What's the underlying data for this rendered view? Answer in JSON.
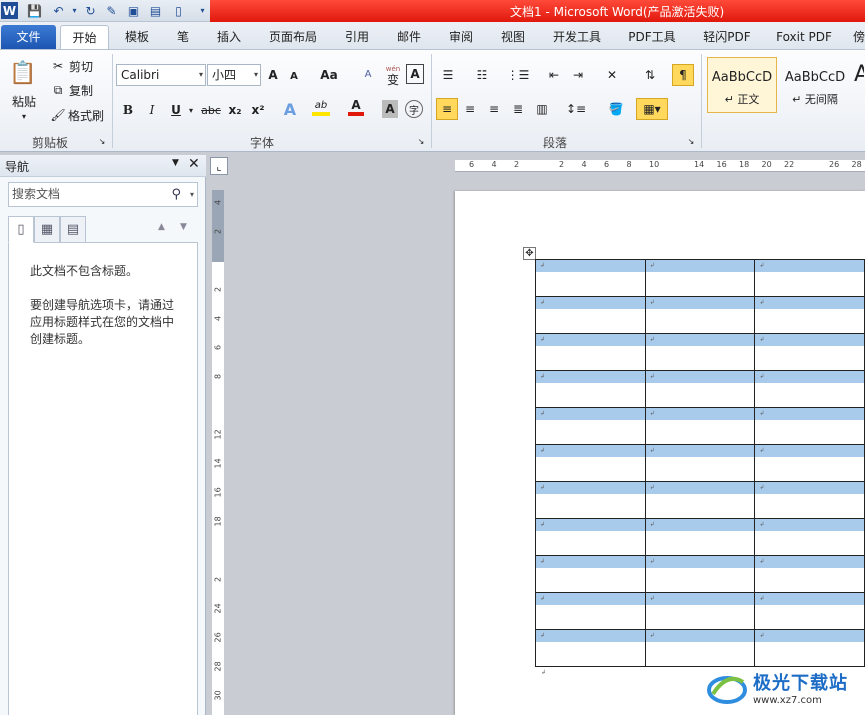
{
  "window": {
    "title": "文档1 - Microsoft Word(产品激活失败)"
  },
  "tabs": [
    {
      "label": "文件"
    },
    {
      "label": "开始"
    },
    {
      "label": "模板"
    },
    {
      "label": "笔"
    },
    {
      "label": "插入"
    },
    {
      "label": "页面布局"
    },
    {
      "label": "引用"
    },
    {
      "label": "邮件"
    },
    {
      "label": "审阅"
    },
    {
      "label": "视图"
    },
    {
      "label": "开发工具"
    },
    {
      "label": "PDF工具"
    },
    {
      "label": "轻闪PDF"
    },
    {
      "label": "Foxit PDF"
    },
    {
      "label": "傍"
    }
  ],
  "clipboard": {
    "paste": "粘贴",
    "cut": "剪切",
    "copy": "复制",
    "format_painter": "格式刷",
    "label": "剪贴板"
  },
  "font": {
    "name": "Calibri",
    "size": "小四",
    "label": "字体",
    "grow": "A",
    "shrink": "A",
    "case": "Aa",
    "bold": "B",
    "italic": "I",
    "underline": "U",
    "strike": "abc",
    "sub": "x₂",
    "sup": "x²",
    "text_effect": "A",
    "highlight": "ab",
    "color": "A",
    "char_shade": "A",
    "enclose": "字",
    "phonetic": "wén",
    "phonetic_char": "变",
    "border_char": "A",
    "clear": "A"
  },
  "paragraph": {
    "label": "段落"
  },
  "styles": [
    {
      "sample": "AaBbCcD",
      "name": "↵ 正文"
    },
    {
      "sample": "AaBbCcD",
      "name": "↵ 无间隔"
    },
    {
      "sample": "A",
      "name": ""
    }
  ],
  "nav": {
    "title": "导航",
    "search_placeholder": "搜索文档",
    "msg1": "此文档不包含标题。",
    "msg2": "要创建导航选项卡，请通过应用标题样式在您的文档中创建标题。"
  },
  "ruler": {
    "h_ticks": [
      "6",
      "4",
      "2",
      "",
      "2",
      "4",
      "6",
      "8",
      "10",
      "",
      "14",
      "16",
      "18",
      "20",
      "22",
      "",
      "26",
      "28"
    ],
    "v_ticks": [
      "4",
      "2",
      "",
      "2",
      "4",
      "6",
      "8",
      "",
      "12",
      "14",
      "16",
      "18",
      "",
      "2",
      "24",
      "26",
      "28",
      "30"
    ]
  },
  "table": {
    "rows": 11,
    "cols": 3,
    "cell_mark": "↲"
  },
  "watermark": {
    "text": "极光下载站",
    "url": "www.xz7.com"
  },
  "colors": {
    "accent": "#1d56b2",
    "title_red": "#e0180c",
    "cell_highlight": "#a8cbec"
  }
}
